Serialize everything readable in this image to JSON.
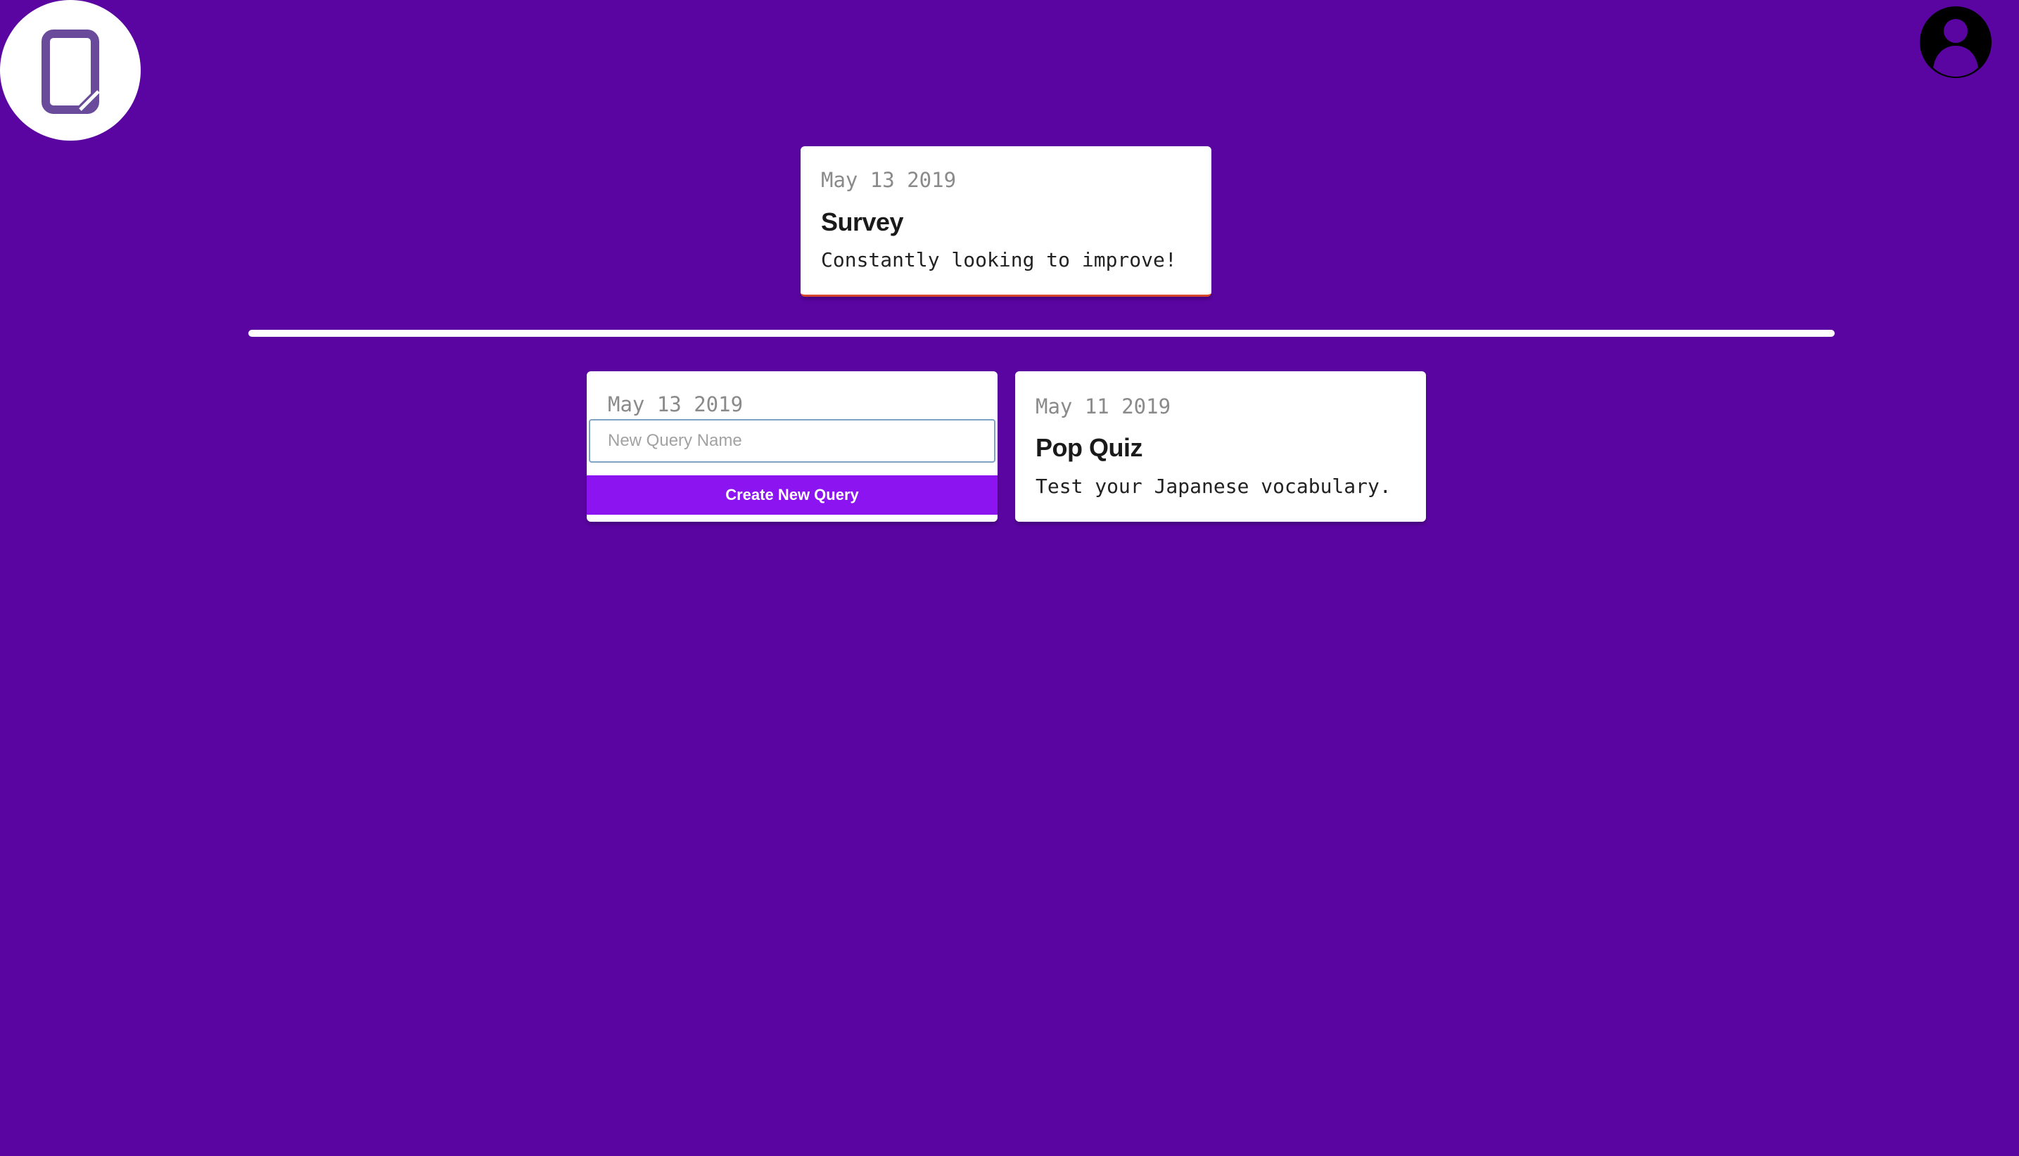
{
  "colors": {
    "background": "#5a05a2",
    "card_background": "#ffffff",
    "date_text": "#8a8a8a",
    "title_text": "#1a1a1a",
    "body_text": "#222222",
    "button": "#8c14f0",
    "button_text": "#ffffff",
    "logo_mark": "#6a4a9a"
  },
  "header": {
    "logo_icon": "document-logo-icon",
    "avatar_icon": "user-avatar-icon"
  },
  "featured": {
    "date": "May 13 2019",
    "title": "Survey",
    "description": "Constantly looking to improve!"
  },
  "new_query": {
    "date": "May 13 2019",
    "placeholder": "New Query Name",
    "value": "",
    "button_label": "Create New Query"
  },
  "queries": [
    {
      "date": "May 11 2019",
      "title": "Pop Quiz",
      "description": "Test your Japanese vocabulary."
    }
  ]
}
